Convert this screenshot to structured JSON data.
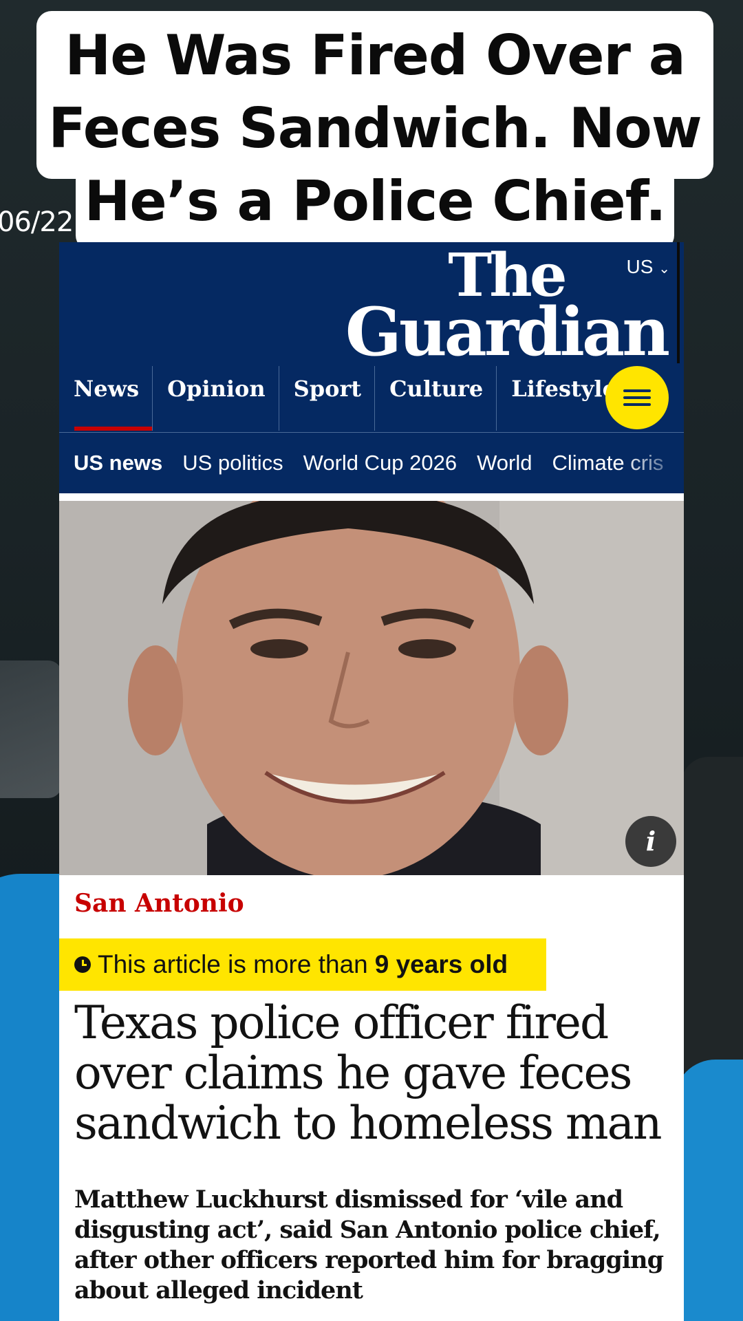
{
  "overlay": {
    "headline_line1": "He Was Fired Over a",
    "headline_line2": "Feces Sandwich. Now",
    "headline_line3": "He’s a Police Chief.",
    "date_stamp": "06/22"
  },
  "guardian": {
    "edition_label": "US",
    "logo_the": "The",
    "logo_guardian": "Guardian",
    "pillars": [
      "News",
      "Opinion",
      "Sport",
      "Culture",
      "Lifestyle"
    ],
    "active_pillar": "News",
    "subnav": [
      "US news",
      "US politics",
      "World Cup 2026",
      "World",
      "Climate cris"
    ],
    "active_subnav": "US news"
  },
  "article": {
    "section": "San Antonio",
    "age_notice_prefix": "This article is more than",
    "age_notice_bold": "9 years old",
    "headline": "Texas police officer fired over claims he gave feces sandwich to homeless man",
    "standfirst": "Matthew Luckhurst dismissed for ‘vile and disgusting act’, said San Antonio police chief, after other officers reported him for bragging about alleged incident",
    "info_button": "i"
  },
  "colors": {
    "guardian_blue": "#052962",
    "news_red": "#c70000",
    "highlight_yellow": "#ffe500",
    "shirt_blue": "#1684c9"
  },
  "icons": [
    "chevron-down-icon",
    "menu-icon",
    "clock-icon",
    "info-icon"
  ]
}
